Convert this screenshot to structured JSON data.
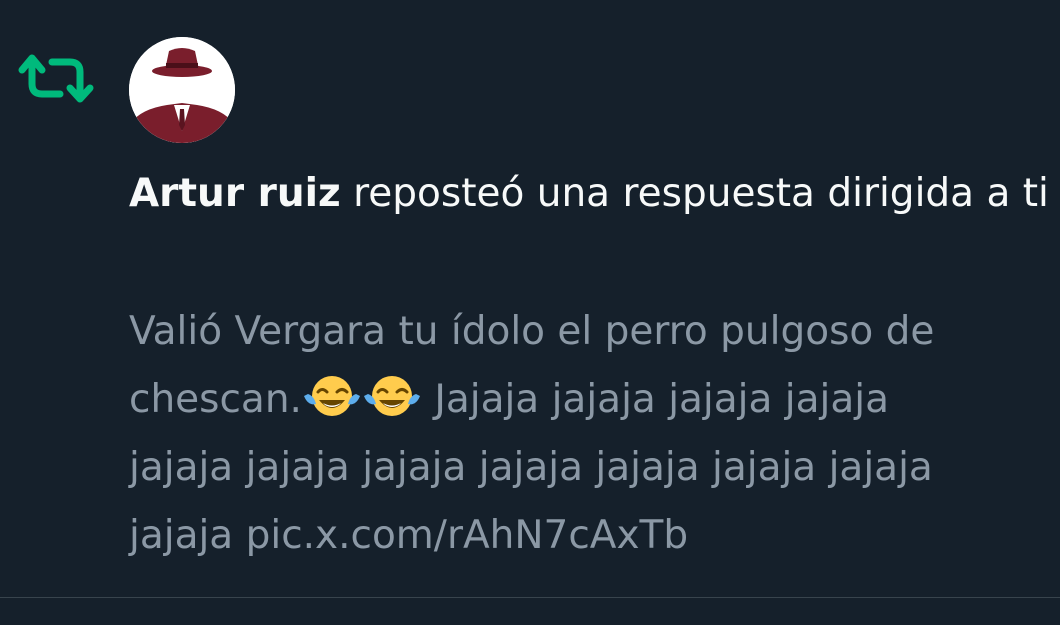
{
  "notification": {
    "icon": "repost-icon",
    "accent_color": "#00ba7c",
    "actor_name": "Artur ruiz",
    "action_text": " reposteó una respuesta dirigida a ti",
    "tweet_lines": [
      "Valió Vergara tu ídolo el perro pulgoso de",
      "chescan.",
      " Jajaja jajaja jajaja jajaja",
      "jajaja jajaja jajaja jajaja jajaja jajaja jajaja",
      "jajaja pic.x.com/rAhN7cAxTb"
    ],
    "emoji": [
      "face-with-tears-of-joy-icon",
      "face-with-tears-of-joy-icon"
    ]
  },
  "colors": {
    "background": "#15202b",
    "primary_text": "#f7f9f9",
    "secondary_text": "#8b98a5",
    "divider": "#38444d"
  }
}
